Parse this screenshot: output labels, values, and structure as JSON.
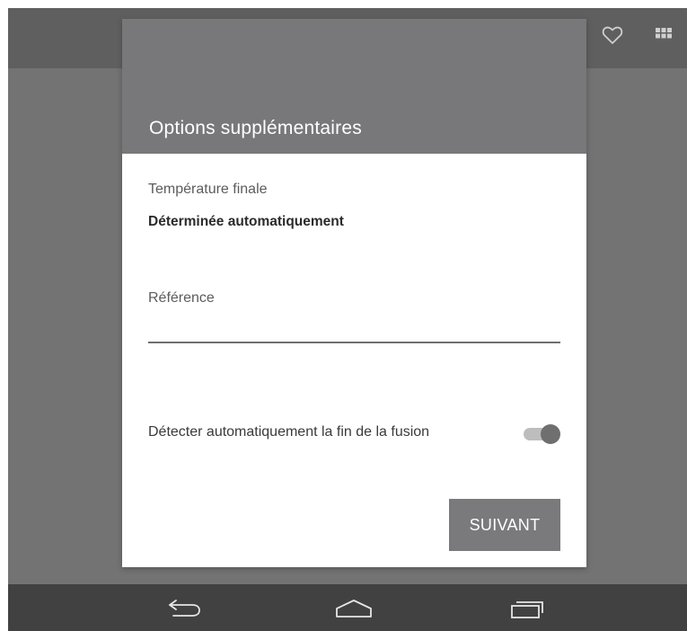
{
  "app_bar": {
    "icons": [
      "favorite-heart-icon",
      "grid-apps-icon"
    ]
  },
  "dialog": {
    "title": "Options supplémentaires",
    "final_temperature": {
      "label": "Température finale",
      "value": "Déterminée automatiquement"
    },
    "reference": {
      "placeholder": "Référence",
      "value": ""
    },
    "auto_detect": {
      "label": "Détecter automatiquement la fin de la fusion",
      "enabled": true
    },
    "next_button": "SUIVANT"
  },
  "nav_bar": {
    "icons": [
      "back-icon",
      "home-icon",
      "recent-apps-icon"
    ]
  },
  "colors": {
    "overlay_background": "#737373",
    "app_bar": "#5f5f5f",
    "dialog_header": "#78787a",
    "button": "#7a7a7c",
    "nav_bar": "#414141"
  }
}
